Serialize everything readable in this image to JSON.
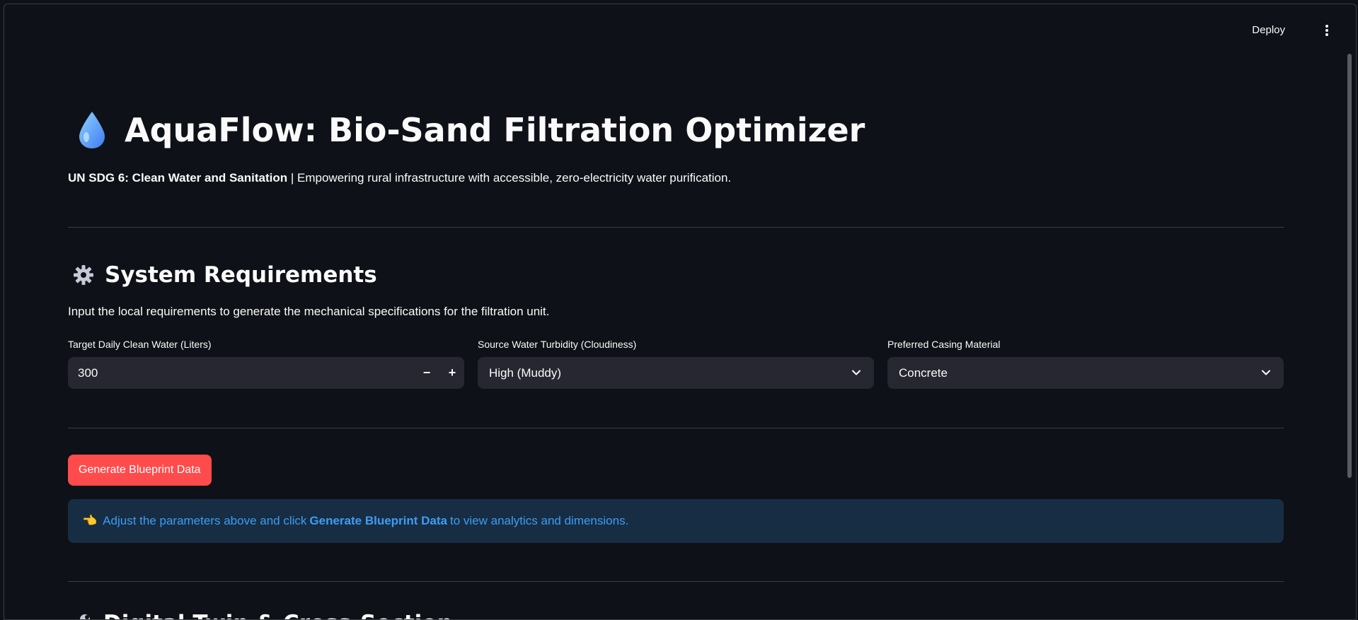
{
  "header": {
    "deploy_label": "Deploy",
    "menu_icon": "kebab-menu-icon"
  },
  "app": {
    "title": "AquaFlow: Bio-Sand Filtration Optimizer",
    "title_icon": "water-drop-icon",
    "subtitle_bold": "UN SDG 6: Clean Water and Sanitation",
    "subtitle_rest": " | Empowering rural infrastructure with accessible, zero-electricity water purification."
  },
  "requirements": {
    "heading": "System Requirements",
    "heading_icon": "gear-icon",
    "description": "Input the local requirements to generate the mechanical specifications for the filtration unit.",
    "fields": {
      "water": {
        "label": "Target Daily Clean Water (Liters)",
        "value": "300",
        "minus": "−",
        "plus": "+"
      },
      "turbidity": {
        "label": "Source Water Turbidity (Cloudiness)",
        "value": "High (Muddy)"
      },
      "material": {
        "label": "Preferred Casing Material",
        "value": "Concrete"
      }
    }
  },
  "actions": {
    "generate_label": "Generate Blueprint Data"
  },
  "info": {
    "icon": "pointing-hand-icon",
    "glyph": "👈",
    "text_before": "Adjust the parameters above and click ",
    "text_bold": "Generate Blueprint Data",
    "text_after": " to view analytics and dimensions."
  },
  "next_section": {
    "heading": "Digital Twin & Cross-Section",
    "heading_icon": "wrench-icon"
  },
  "colors": {
    "background": "#0e1117",
    "accent": "#ff4b4b",
    "info_bg": "#172d43",
    "info_text": "#3d9df3"
  }
}
